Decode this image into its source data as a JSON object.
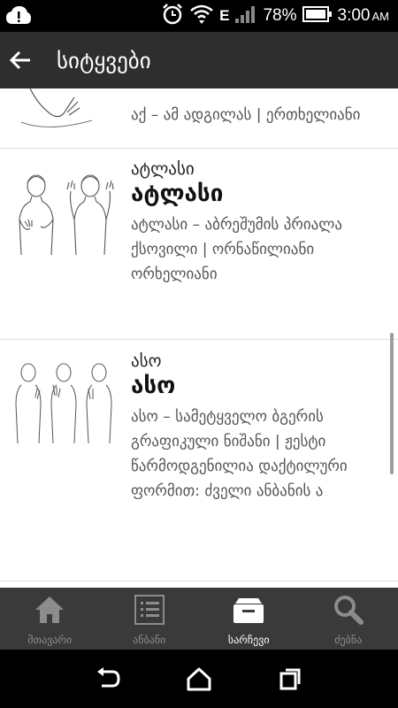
{
  "status_bar": {
    "network_type": "E",
    "battery_percent": "78%",
    "time": "3:00",
    "ampm": "AM",
    "icons": [
      "cloud-upload-icon",
      "alarm-icon",
      "wifi-icon",
      "signal-icon",
      "battery-icon"
    ]
  },
  "app_bar": {
    "title": "სიტყვები",
    "back_icon": "arrow-back-icon"
  },
  "entries": [
    {
      "title_small": "",
      "title_big": "",
      "definition": "აქ – ამ ადგილას | ერთხელიანი"
    },
    {
      "title_small": "ატლასი",
      "title_big": "ატლასი",
      "definition": "ატლასი – აბრეშუმის პრიალა ქსოვილი | ორნაწილიანი ორხელიანი"
    },
    {
      "title_small": "ასო",
      "title_big": "ასო",
      "definition": "ასო – სამეტყველო ბგერის გრაფიკული ნიშანი | ჟესტი წარმოდგენილია დაქტილური ფორმით: ძველი ანბანის ა"
    }
  ],
  "bottom_nav": {
    "items": [
      {
        "label": "მთავარი",
        "icon": "home-icon",
        "active": false
      },
      {
        "label": "ანბანი",
        "icon": "list-icon",
        "active": false
      },
      {
        "label": "სარჩევი",
        "icon": "folder-icon",
        "active": true
      },
      {
        "label": "ძებნა",
        "icon": "search-icon",
        "active": false
      }
    ]
  },
  "system_nav": {
    "icons": [
      "back-icon",
      "home-outline-icon",
      "recent-apps-icon"
    ]
  },
  "colors": {
    "app_bar": "#2e2e2e",
    "bottom_nav": "#3a3a3a",
    "active_label": "#ffffff",
    "inactive_label": "#8c8c8c"
  }
}
